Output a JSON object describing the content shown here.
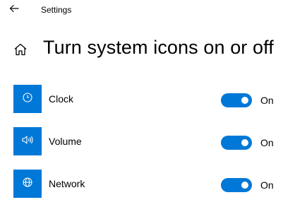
{
  "window": {
    "title": "Settings"
  },
  "page": {
    "title": "Turn system icons on or off"
  },
  "colors": {
    "accent": "#0078d7",
    "knob": "#ffffff"
  },
  "items": [
    {
      "label": "Clock",
      "icon": "clock-icon",
      "state": "On",
      "checked": true
    },
    {
      "label": "Volume",
      "icon": "volume-icon",
      "state": "On",
      "checked": true
    },
    {
      "label": "Network",
      "icon": "network-icon",
      "state": "On",
      "checked": true
    }
  ]
}
